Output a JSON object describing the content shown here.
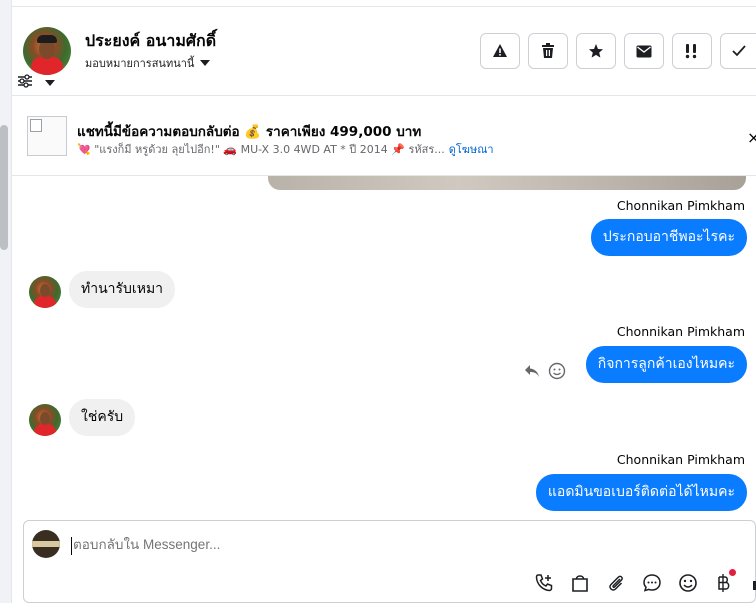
{
  "header": {
    "contact_name": "ประยงค์ อนามศักดิ์",
    "assign_label": "มอบหมายการสนทนานี้",
    "actions": [
      {
        "name": "report-spam-button",
        "icon": "warning-icon"
      },
      {
        "name": "delete-button",
        "icon": "trash-icon"
      },
      {
        "name": "star-button",
        "icon": "star-icon"
      },
      {
        "name": "mark-unread-button",
        "icon": "envelope-icon"
      },
      {
        "name": "follow-up-button",
        "icon": "exclamation-icon"
      },
      {
        "name": "done-button",
        "icon": "check-icon"
      }
    ]
  },
  "ad": {
    "title": "แชทนี้มีข้อความตอบกลับต่อ 💰 ราคาเพียง 499,000 บาท",
    "subtitle": "💘 \"แรงก็มี หรูด้วย ลุยไปอีก!\" 🚗 MU-X 3.0 4WD AT * ปี 2014 📌 รหัสร...",
    "view_ad_link": "ดูโฆษณา",
    "close_glyph": "×"
  },
  "messages": [
    {
      "direction": "out",
      "sender": "Chonnikan Pimkham",
      "text": "ประกอบอาชีพอะไรคะ"
    },
    {
      "direction": "in",
      "text": "ทำนารับเหมา"
    },
    {
      "direction": "out",
      "sender": "Chonnikan Pimkham",
      "text": "กิจการลูกค้าเองไหมคะ"
    },
    {
      "direction": "in",
      "text": "ใช่ครับ"
    },
    {
      "direction": "out",
      "sender": "Chonnikan Pimkham",
      "text": "แอดมินขอเบอร์ติดต่อได้ไหมคะ"
    }
  ],
  "composer": {
    "placeholder": "ตอบกลับใน Messenger...",
    "tools": [
      "add-call-icon",
      "bag-icon",
      "paperclip-icon",
      "chat-bubble-icon",
      "emoji-icon",
      "baht-icon",
      "thumb-icon"
    ]
  },
  "colors": {
    "accent": "#0a7cff",
    "incoming_bubble": "#f0f0f0",
    "link": "#0064d1",
    "notification_dot": "#e41e3f"
  }
}
